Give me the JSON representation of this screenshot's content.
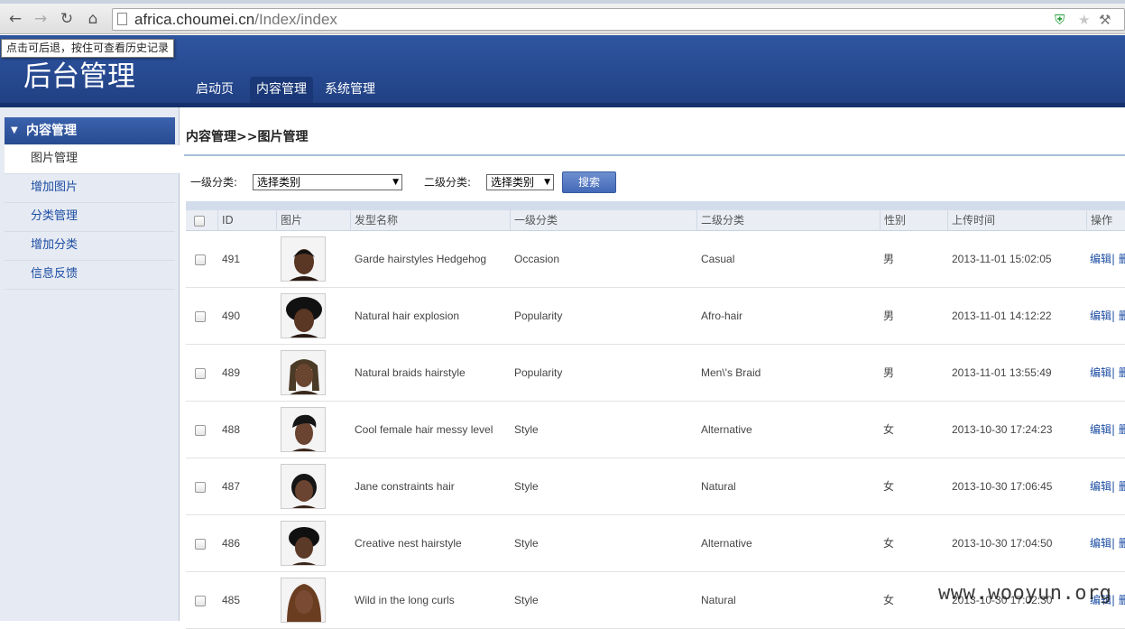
{
  "browser": {
    "url_host": "africa.choumei.cn",
    "url_path": "/Index/index",
    "tooltip": "点击可后退，按住可查看历史记录"
  },
  "header": {
    "title": "后台管理",
    "nav": [
      {
        "label": "启动页",
        "active": false
      },
      {
        "label": "内容管理",
        "active": true
      },
      {
        "label": "系统管理",
        "active": false
      }
    ]
  },
  "sidebar": {
    "section": "内容管理",
    "items": [
      {
        "label": "图片管理",
        "active": true
      },
      {
        "label": "增加图片",
        "active": false
      },
      {
        "label": "分类管理",
        "active": false
      },
      {
        "label": "增加分类",
        "active": false
      },
      {
        "label": "信息反馈",
        "active": false
      }
    ]
  },
  "main": {
    "breadcrumb": "内容管理>>图片管理",
    "filter": {
      "level1_label": "一级分类:",
      "level1_value": "选择类别",
      "level2_label": "二级分类:",
      "level2_value": "选择类别",
      "search_label": "搜索"
    },
    "table": {
      "headers": [
        "ID",
        "图片",
        "发型名称",
        "一级分类",
        "二级分类",
        "性别",
        "上传时间",
        "操作"
      ],
      "action_label": "编辑| 删",
      "rows": [
        {
          "id": "491",
          "name": "Garde hairstyles Hedgehog",
          "cat1": "Occasion",
          "cat2": "Casual",
          "gender": "男",
          "time": "2013-11-01 15:02:05",
          "thumb": "short-male"
        },
        {
          "id": "490",
          "name": "Natural hair explosion",
          "cat1": "Popularity",
          "cat2": "Afro-hair",
          "gender": "男",
          "time": "2013-11-01 14:12:22",
          "thumb": "afro-male"
        },
        {
          "id": "489",
          "name": "Natural braids hairstyle",
          "cat1": "Popularity",
          "cat2": "Men\\'s Braid",
          "gender": "男",
          "time": "2013-11-01 13:55:49",
          "thumb": "braids-male"
        },
        {
          "id": "488",
          "name": "Cool female hair messy level",
          "cat1": "Style",
          "cat2": "Alternative",
          "gender": "女",
          "time": "2013-10-30 17:24:23",
          "thumb": "messy-female"
        },
        {
          "id": "487",
          "name": "Jane constraints hair",
          "cat1": "Style",
          "cat2": "Natural",
          "gender": "女",
          "time": "2013-10-30 17:06:45",
          "thumb": "slick-female"
        },
        {
          "id": "486",
          "name": "Creative nest hairstyle",
          "cat1": "Style",
          "cat2": "Alternative",
          "gender": "女",
          "time": "2013-10-30 17:04:50",
          "thumb": "nest-female"
        },
        {
          "id": "485",
          "name": "Wild in the long curls",
          "cat1": "Style",
          "cat2": "Natural",
          "gender": "女",
          "time": "2013-10-30 17:02:30",
          "thumb": "curls-female"
        }
      ]
    }
  },
  "watermark": "www.wooyun.org",
  "colors": {
    "header_blue": "#284b91",
    "sidebar_bg": "#e6eaf2",
    "link_blue": "#1c4da3"
  }
}
